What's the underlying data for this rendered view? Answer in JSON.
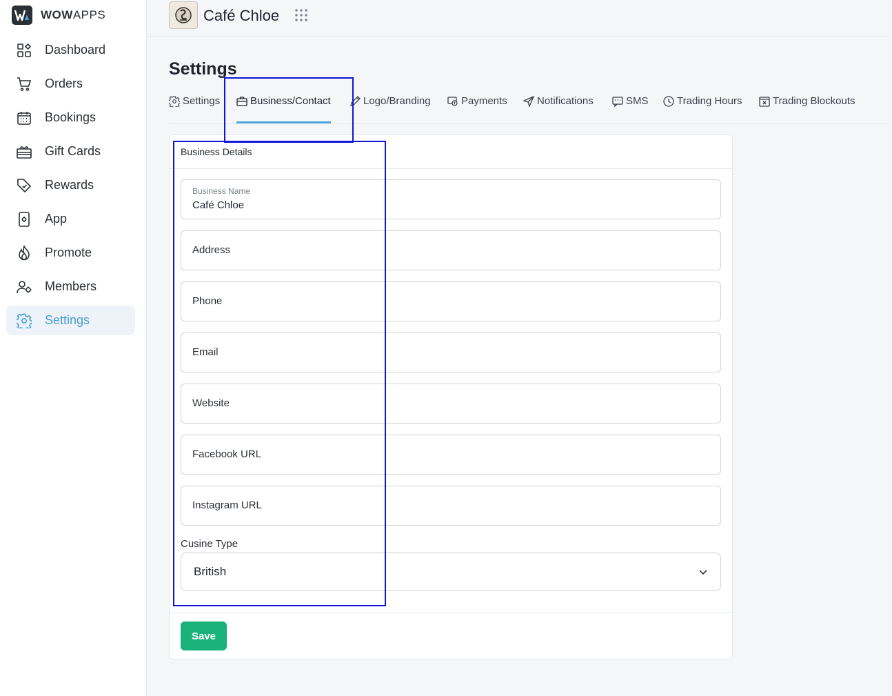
{
  "brand": {
    "name_bold": "WOW",
    "name_rest": "APPS"
  },
  "sidebar": {
    "items": [
      {
        "label": "Dashboard",
        "icon": "dashboard-icon"
      },
      {
        "label": "Orders",
        "icon": "cart-icon"
      },
      {
        "label": "Bookings",
        "icon": "calendar-icon"
      },
      {
        "label": "Gift Cards",
        "icon": "gift-card-icon"
      },
      {
        "label": "Rewards",
        "icon": "tag-icon"
      },
      {
        "label": "App",
        "icon": "phone-icon"
      },
      {
        "label": "Promote",
        "icon": "fire-icon"
      },
      {
        "label": "Members",
        "icon": "members-icon"
      },
      {
        "label": "Settings",
        "icon": "gear-icon",
        "active": true
      }
    ]
  },
  "header": {
    "business_name": "Café Chloe"
  },
  "page": {
    "title": "Settings"
  },
  "tabs": [
    {
      "label": "Settings",
      "icon": "gear-icon"
    },
    {
      "label": "Business/Contact",
      "icon": "briefcase-icon",
      "active": true
    },
    {
      "label": "Logo/Branding",
      "icon": "pen-icon"
    },
    {
      "label": "Payments",
      "icon": "payments-icon"
    },
    {
      "label": "Notifications",
      "icon": "send-icon"
    },
    {
      "label": "SMS",
      "icon": "message-icon"
    },
    {
      "label": "Trading Hours",
      "icon": "clock-icon"
    },
    {
      "label": "Trading Blockouts",
      "icon": "calendar-x-icon"
    }
  ],
  "card": {
    "title": "Business Details",
    "business_name_label": "Business Name",
    "business_name_value": "Café Chloe",
    "fields": [
      "Address",
      "Phone",
      "Email",
      "Website",
      "Facebook URL",
      "Instagram URL"
    ],
    "cuisine_label": "Cusine Type",
    "cuisine_value": "British",
    "save_label": "Save"
  },
  "colors": {
    "accent": "#4aa3d6",
    "save": "#19b27b",
    "highlight": "#1414d9"
  }
}
